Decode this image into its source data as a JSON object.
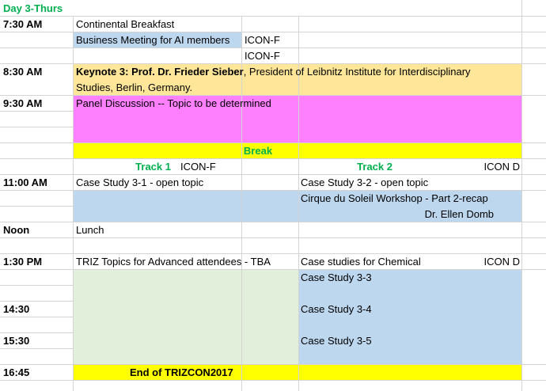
{
  "title": "Day 3-Thurs",
  "colors": {
    "blue": "#bdd7ee",
    "orange": "#ffe699",
    "magenta": "#ff80ff",
    "yellow": "#ffff00",
    "light_green": "#e2efda",
    "title_green": "#00b050"
  },
  "rows": {
    "r730": {
      "time": "7:30 AM",
      "item1": "Continental Breakfast",
      "item2": "Business Meeting for AI members",
      "item2_loc": "ICON-F",
      "item3_loc": "ICON-F"
    },
    "r830": {
      "time": "8:30 AM",
      "keynote_label": "Keynote 3:  Prof. Dr. Frieder Sieber",
      "keynote_rest": ", President of Leibnitz Institute for Interdisciplinary",
      "keynote_line2": "Studies, Berlin, Germany."
    },
    "r930": {
      "time": "9:30 AM",
      "panel": "Panel Discussion -- Topic to be determined"
    },
    "break": "Break",
    "tracks": {
      "track1": "Track 1",
      "track1_loc": "ICON-F",
      "track2": "Track 2",
      "track2_loc": "ICON D"
    },
    "r1100": {
      "time": "11:00 AM",
      "case1": "Case Study 3-1 - open topic",
      "case2": "Case Study 3-2 - open topic",
      "cirque": "Cirque du Soleil Workshop - Part 2-recap",
      "presenter": "Dr. Ellen Domb"
    },
    "noon": {
      "time": "Noon",
      "lunch": "Lunch"
    },
    "r130": {
      "time": "1:30 PM",
      "triz": "TRIZ Topics for Advanced attendees - TBA",
      "chemical": "Case studies for Chemical",
      "chemical_loc": "ICON D",
      "case3": "Case Study 3-3"
    },
    "r1430": {
      "time": "14:30",
      "case4": "Case Study 3-4"
    },
    "r1530": {
      "time": "15:30",
      "case5": "Case Study 3-5"
    },
    "r1645": {
      "time": "16:45",
      "end": "End of TRIZCON2017"
    }
  }
}
